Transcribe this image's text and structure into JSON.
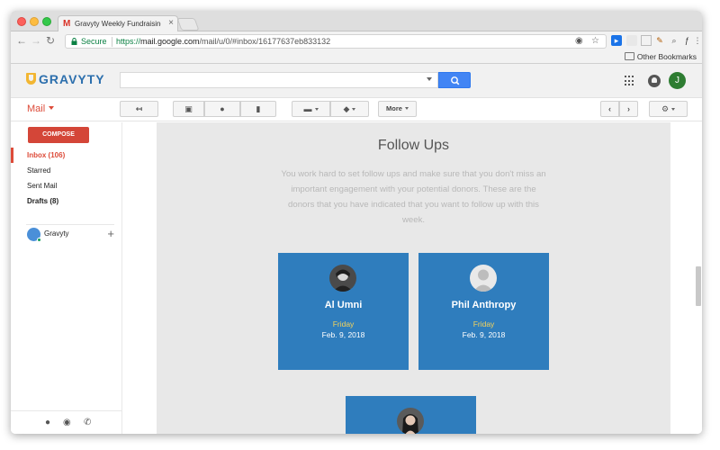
{
  "browser": {
    "tab_title": "Gravyty Weekly Fundraising Re",
    "tab_close": "×",
    "secure_label": "Secure",
    "url_scheme": "https://",
    "url_host": "mail.google.com",
    "url_path": "/mail/u/0/#inbox/16177637eb833132",
    "other_bookmarks": "Other Bookmarks"
  },
  "header": {
    "logo_text": "GRAVYTY",
    "avatar_initial": "J"
  },
  "actions": {
    "mail_label": "Mail",
    "more_label": "More"
  },
  "sidebar": {
    "compose_label": "COMPOSE",
    "items": [
      {
        "label": "Inbox (106)",
        "active": true
      },
      {
        "label": "Starred"
      },
      {
        "label": "Sent Mail"
      },
      {
        "label": "Drafts (8)"
      }
    ],
    "hangouts_user": "Gravyty",
    "add_label": "+"
  },
  "follow_ups": {
    "title": "Follow Ups",
    "description": "You work hard to set follow ups and make sure that you don't miss an important engagement with your potential donors. These are the donors that you have indicated that you want to follow up with this week.",
    "donors": [
      {
        "name": "Al Umni",
        "day": "Friday",
        "date": "Feb. 9, 2018"
      },
      {
        "name": "Phil Anthropy",
        "day": "Friday",
        "date": "Feb. 9, 2018"
      },
      {
        "name": "",
        "day": "",
        "date": ""
      }
    ]
  },
  "colors": {
    "card": "#2f7dbd",
    "day": "#f5d35a",
    "compose": "#d44638",
    "brand": "#2c6fad"
  }
}
